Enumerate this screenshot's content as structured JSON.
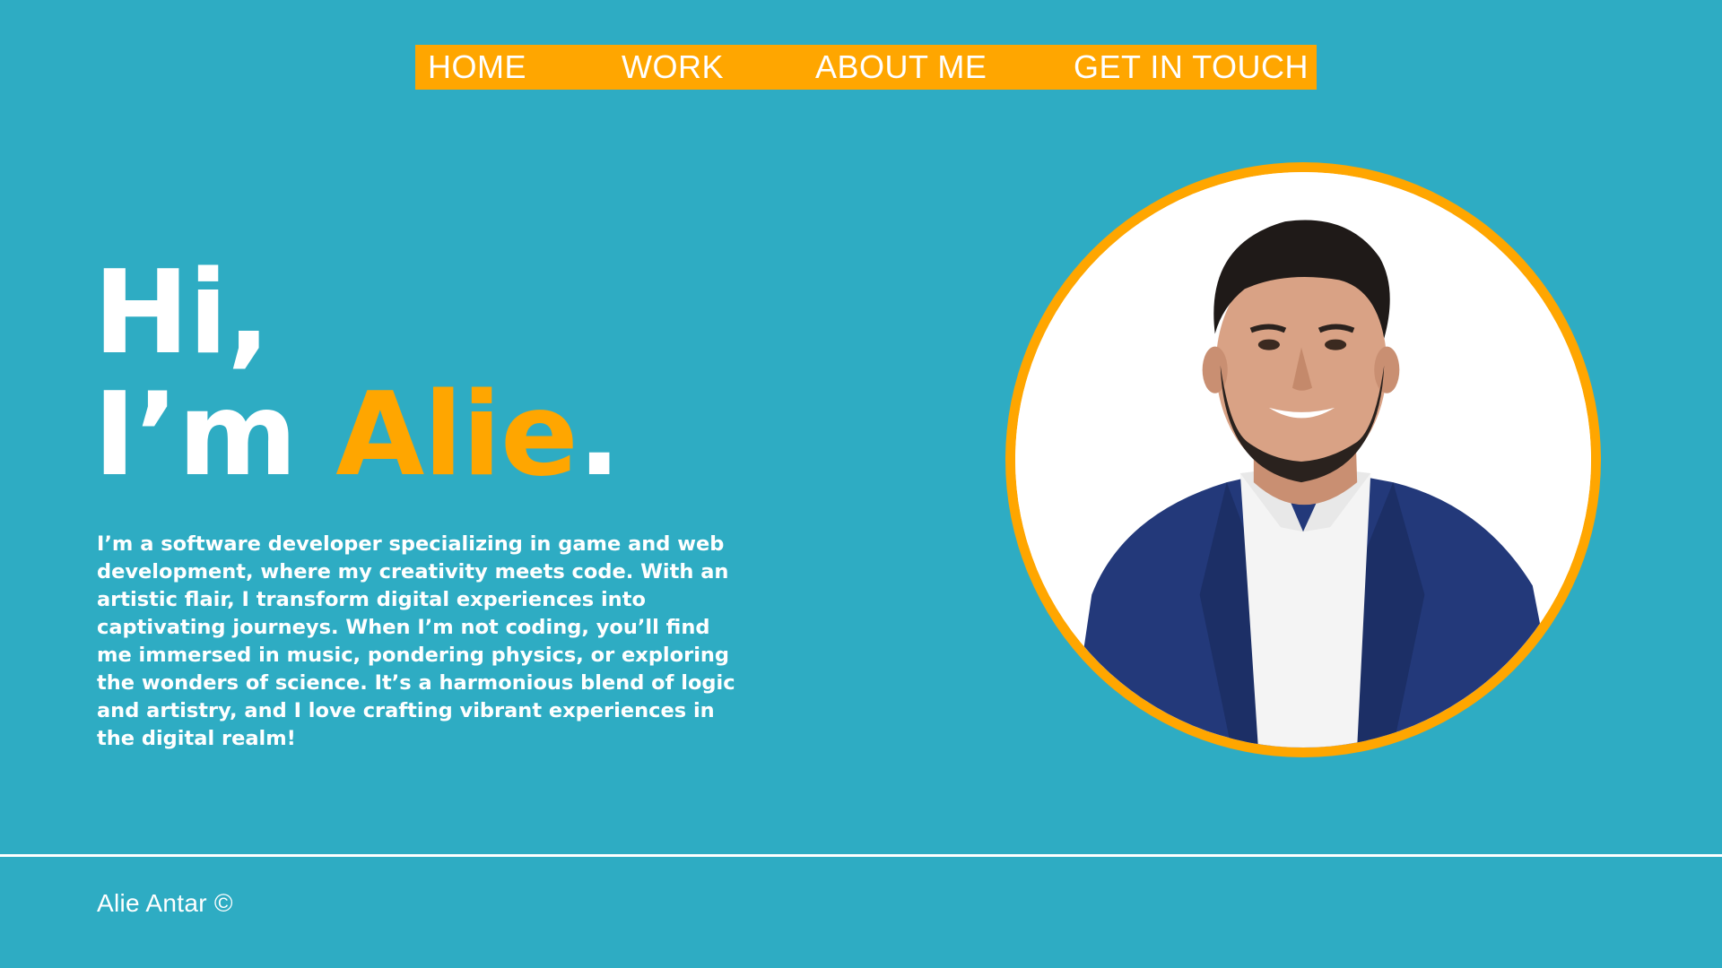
{
  "nav": {
    "items": [
      {
        "label": "HOME"
      },
      {
        "label": "WORK"
      },
      {
        "label": "ABOUT ME"
      },
      {
        "label": "GET IN TOUCH"
      }
    ]
  },
  "hero": {
    "greeting": "Hi,",
    "intro_prefix": "I’m ",
    "name": "Alie",
    "period": ".",
    "bio": "I’m a software developer specializing in game and web development, where my creativity meets code. With an artistic flair, I transform digital experiences into captivating journeys. When I’m not coding, you’ll find me immersed in music, pondering physics, or exploring the wonders of science. It’s a harmonious blend of logic and artistry, and I love crafting vibrant experiences in the digital realm!"
  },
  "portrait": {
    "icon": "profile-photo"
  },
  "footer": {
    "copyright": "Alie Antar ©"
  },
  "colors": {
    "background": "#2eacc3",
    "accent": "#ffa600",
    "text": "#ffffff"
  }
}
